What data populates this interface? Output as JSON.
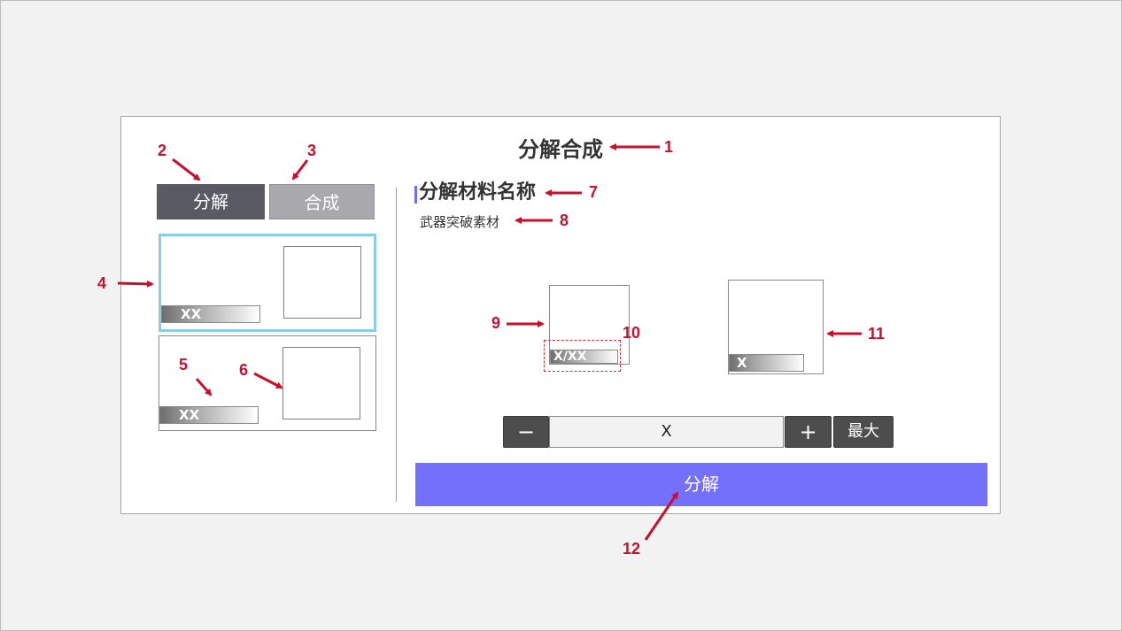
{
  "title": "分解合成",
  "tabs": {
    "decompose": "分解",
    "synthesize": "合成"
  },
  "item_list": [
    {
      "count": "XX",
      "selected": true
    },
    {
      "count": "XX",
      "selected": false
    }
  ],
  "detail": {
    "material_name": "分解材料名称",
    "material_type": "武器突破素材",
    "input_slot_count": "X/XX",
    "output_slot_count": "X"
  },
  "quantity": {
    "minus": "−",
    "value": "X",
    "plus": "+",
    "max": "最大"
  },
  "action_button": "分解",
  "callouts": [
    "1",
    "2",
    "3",
    "4",
    "5",
    "6",
    "7",
    "8",
    "9",
    "10",
    "11",
    "12"
  ],
  "colors": {
    "accent": "#7470fb",
    "selected_border": "#87ceeb",
    "callout": "#c8102e",
    "active_tab": "#5a5a64",
    "inactive_tab": "#a9a9ad"
  }
}
